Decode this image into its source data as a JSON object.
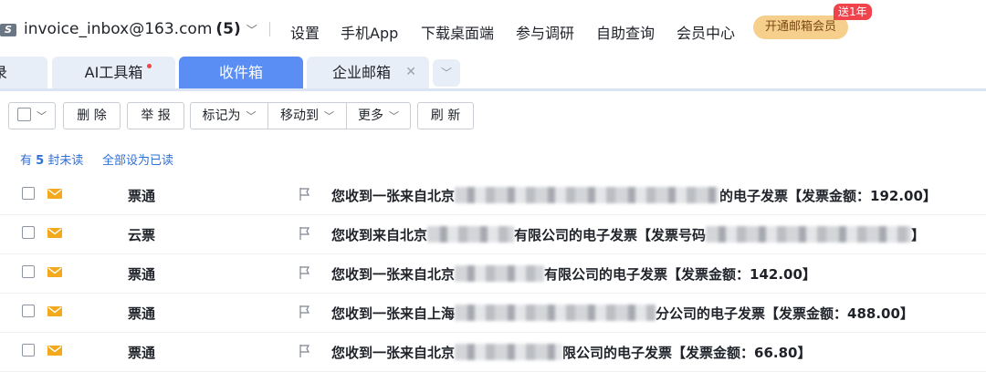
{
  "header": {
    "account": "invoice_inbox@163.com",
    "count": "(5)",
    "nav": [
      "设置",
      "手机App",
      "下载桌面端",
      "参与调研",
      "自助查询",
      "会员中心"
    ],
    "vip_label": "开通邮箱会员",
    "vip_badge": "送1年"
  },
  "tabs": [
    {
      "label": "录"
    },
    {
      "label": "AI工具箱"
    },
    {
      "label": "收件箱"
    },
    {
      "label": "企业邮箱"
    }
  ],
  "toolbar": {
    "delete": "删 除",
    "report": "举 报",
    "mark_as": "标记为",
    "move_to": "移动到",
    "more": "更多",
    "refresh": "刷 新"
  },
  "summary": {
    "prefix": "有",
    "count": "5",
    "suffix": "封未读",
    "mark_all": "全部设为已读"
  },
  "mails": [
    {
      "sender": "票通",
      "subj_a": "您收到一张来自北京",
      "subj_b": "的电子发票【发票金额：192.00】"
    },
    {
      "sender": "云票",
      "subj_a": "您收到来自北京",
      "subj_b": "有限公司的电子发票【发票号码",
      "subj_c": "】"
    },
    {
      "sender": "票通",
      "subj_a": "您收到一张来自北京",
      "subj_b": "有限公司的电子发票【发票金额：142.00】"
    },
    {
      "sender": "票通",
      "subj_a": "您收到一张来自上海",
      "subj_b": "分公司的电子发票【发票金额：488.00】"
    },
    {
      "sender": "票通",
      "subj_a": "您收到一张来自北京",
      "subj_b": "限公司的电子发票【发票金额：66.80】"
    }
  ],
  "colors": {
    "accent": "#5b8ef5",
    "link": "#2f6fd6",
    "envelope": "#f2a91d",
    "vip": "#f7cf8d",
    "badge": "#f0434c"
  }
}
